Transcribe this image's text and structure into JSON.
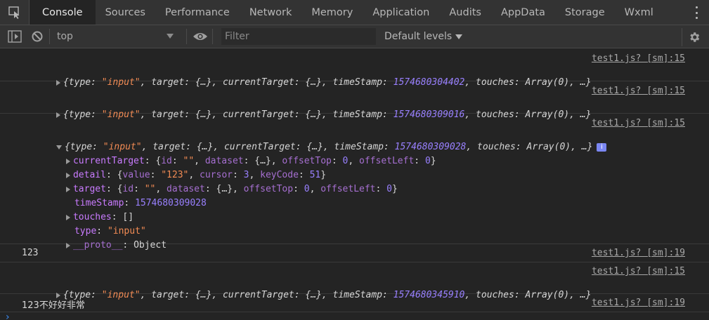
{
  "tabs": [
    "Console",
    "Sources",
    "Performance",
    "Network",
    "Memory",
    "Application",
    "Audits",
    "AppData",
    "Storage",
    "Wxml"
  ],
  "active_tab": "Console",
  "toolbar": {
    "context": "top",
    "filter_placeholder": "Filter",
    "levels": "Default levels"
  },
  "messages": [
    {
      "source": "test1.js? [sm]:15",
      "summary": {
        "type": "\"input\"",
        "ts": "1574680304402"
      }
    },
    {
      "source": "test1.js? [sm]:15",
      "summary": {
        "type": "\"input\"",
        "ts": "1574680309016"
      }
    },
    {
      "source": "test1.js? [sm]:15",
      "summary": {
        "type": "\"input\"",
        "ts": "1574680309028"
      },
      "expanded": {
        "currentTarget": {
          "key": "currentTarget",
          "id": "\"\"",
          "offsetTop": "0",
          "offsetLeft": "0"
        },
        "detail": {
          "key": "detail",
          "value": "\"123\"",
          "cursor": "3",
          "keyCode": "51"
        },
        "target": {
          "key": "target",
          "id": "\"\"",
          "offsetTop": "0",
          "offsetLeft": "0"
        },
        "timeStamp": {
          "key": "timeStamp",
          "value": "1574680309028"
        },
        "touches": {
          "key": "touches",
          "value": "[]"
        },
        "type": {
          "key": "type",
          "value": "\"input\""
        },
        "proto": {
          "key": "__proto__",
          "value": "Object"
        }
      }
    },
    {
      "source": "test1.js? [sm]:19",
      "text": "123"
    },
    {
      "source": "test1.js? [sm]:15",
      "summary": {
        "type": "\"input\"",
        "ts": "1574680345910"
      }
    },
    {
      "source": "test1.js? [sm]:19",
      "text": "123不好好非常"
    }
  ],
  "labels": {
    "type_key": "type",
    "target_key": "target",
    "target_val": "{…}",
    "current_key": "currentTarget",
    "current_val": "{…}",
    "ts_key": "timeStamp",
    "touches_key": "touches",
    "touches_val": "Array(0)",
    "ellipsis": "…",
    "id_key": "id",
    "dataset_key": "dataset",
    "dataset_val": "{…}",
    "offsetTop_key": "offsetTop",
    "offsetLeft_key": "offsetLeft",
    "value_key": "value",
    "cursor_key": "cursor",
    "keyCode_key": "keyCode",
    "info_badge": "i",
    "prompt": "›"
  },
  "colors": {
    "background": "#242424",
    "bar": "#333333",
    "string": "#f28b54",
    "number": "#9980ff",
    "property": "#c97bff",
    "info": "#7b87f2",
    "prompt": "#3a8cf5"
  }
}
